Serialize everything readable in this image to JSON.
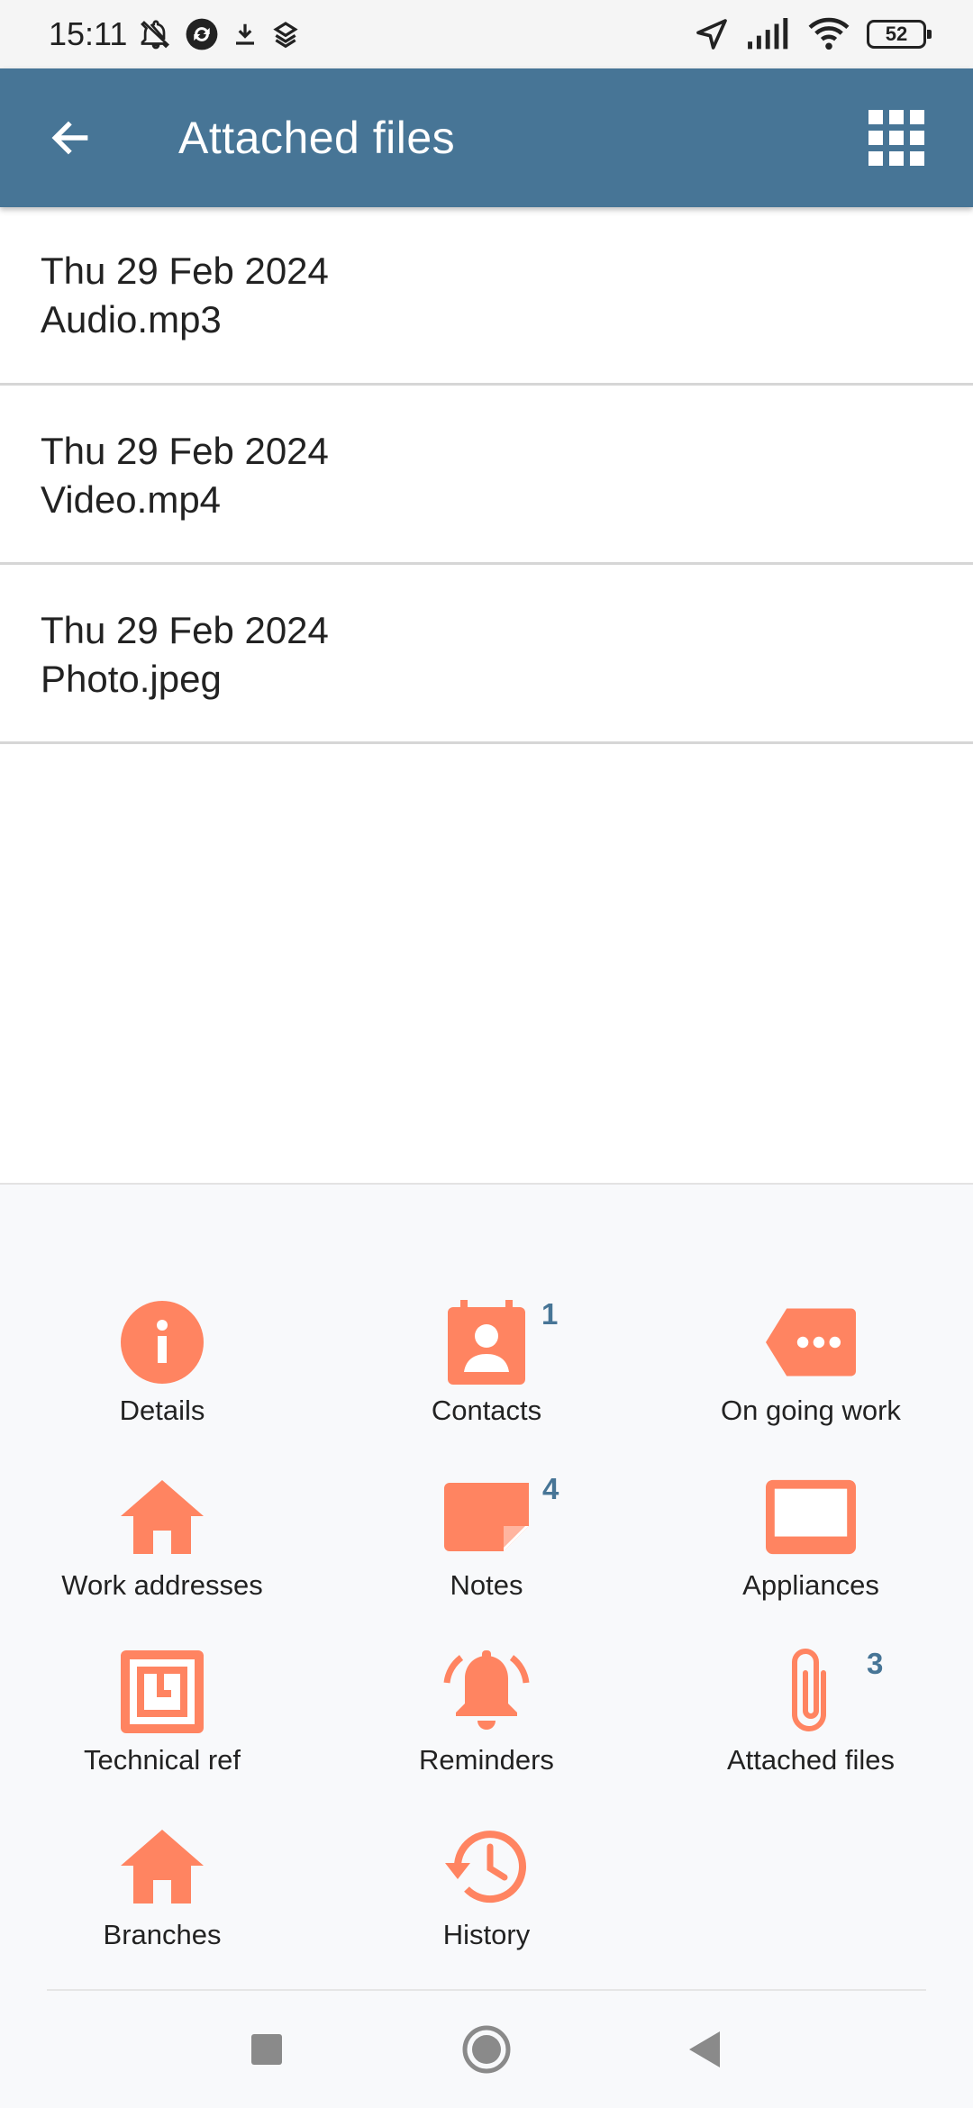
{
  "status_bar": {
    "time": "15:11",
    "battery": "52",
    "icons": [
      "bell-off-icon",
      "sync-icon",
      "download-icon",
      "dropbox-icon",
      "location-arrow-icon",
      "signal-icon",
      "wifi-icon",
      "battery-icon"
    ]
  },
  "app_bar": {
    "title": "Attached files",
    "back_icon": "arrow-back-icon",
    "menu_icon": "grid-icon"
  },
  "files": [
    {
      "date": "Thu 29 Feb 2024",
      "name": "Audio.mp3"
    },
    {
      "date": "Thu 29 Feb 2024",
      "name": "Video.mp4"
    },
    {
      "date": "Thu 29 Feb 2024",
      "name": "Photo.jpeg"
    }
  ],
  "menu": {
    "accent_color": "#FF8461",
    "badge_color": "#477596",
    "items": [
      {
        "label": "Details",
        "icon": "info-icon",
        "badge": ""
      },
      {
        "label": "Contacts",
        "icon": "contact-card-icon",
        "badge": "1"
      },
      {
        "label": "On going work",
        "icon": "tag-icon",
        "badge": ""
      },
      {
        "label": "Work addresses",
        "icon": "home-icon",
        "badge": ""
      },
      {
        "label": "Notes",
        "icon": "note-icon",
        "badge": "4"
      },
      {
        "label": "Appliances",
        "icon": "appliance-icon",
        "badge": ""
      },
      {
        "label": "Technical ref",
        "icon": "technical-ref-icon",
        "badge": ""
      },
      {
        "label": "Reminders",
        "icon": "bell-ringing-icon",
        "badge": ""
      },
      {
        "label": "Attached files",
        "icon": "paperclip-icon",
        "badge": "3"
      },
      {
        "label": "Branches",
        "icon": "home-icon",
        "badge": ""
      },
      {
        "label": "History",
        "icon": "history-icon",
        "badge": ""
      }
    ]
  },
  "nav_bar": {
    "icons": [
      "recents-square-icon",
      "home-circle-icon",
      "back-triangle-icon"
    ]
  }
}
